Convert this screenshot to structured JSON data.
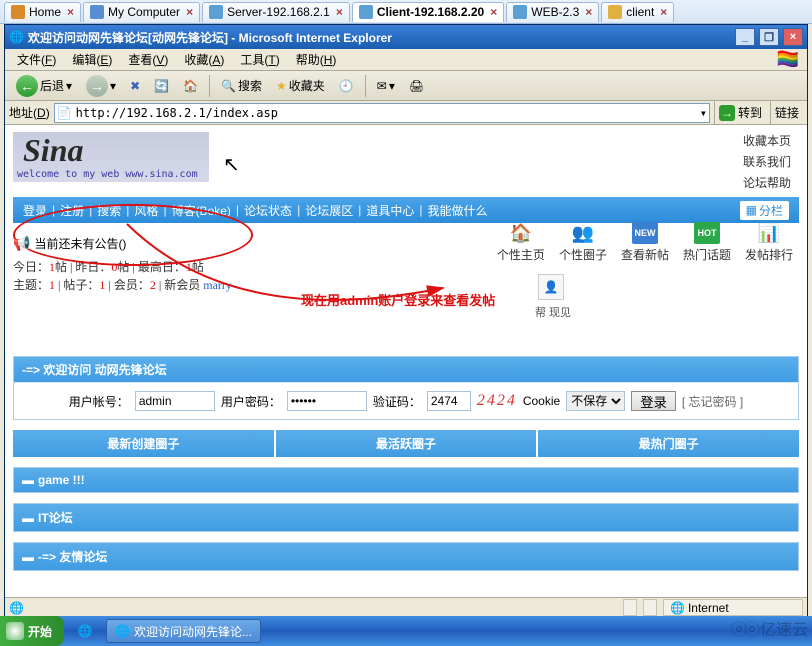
{
  "tabs": [
    {
      "label": "Home",
      "active": false,
      "icon": "#d98a2c"
    },
    {
      "label": "My Computer",
      "active": false,
      "icon": "#5a8ed4"
    },
    {
      "label": "Server-192.168.2.1",
      "active": false,
      "icon": "#5aa0d4"
    },
    {
      "label": "Client-192.168.2.20",
      "active": true,
      "icon": "#5aa0d4"
    },
    {
      "label": "WEB-2.3",
      "active": false,
      "icon": "#5aa0d4"
    },
    {
      "label": "client",
      "active": false,
      "icon": "#e0b040"
    }
  ],
  "ie_title": "欢迎访问动网先锋论坛[动网先锋论坛] - Microsoft Internet Explorer",
  "menu": [
    {
      "label": "文件",
      "u": "F"
    },
    {
      "label": "编辑",
      "u": "E"
    },
    {
      "label": "查看",
      "u": "V"
    },
    {
      "label": "收藏",
      "u": "A"
    },
    {
      "label": "工具",
      "u": "T"
    },
    {
      "label": "帮助",
      "u": "H"
    }
  ],
  "toolbar": {
    "back": "后退",
    "search": "搜索",
    "favorites": "收藏夹"
  },
  "address": {
    "label": "地址",
    "url": "http://192.168.2.1/index.asp",
    "go": "转到",
    "links": "链接"
  },
  "logo": {
    "text": "Sina",
    "sub": "welcome to my web www.sina.com"
  },
  "right_links": [
    "收藏本页",
    "联系我们",
    "论坛帮助"
  ],
  "forum_nav": [
    "登录",
    "注册",
    "搜索",
    "风格",
    "博客(Boke)",
    "论坛状态",
    "论坛展区",
    "道具中心",
    "我能做什么"
  ],
  "share": "分栏",
  "announce": "当前还未有公告()",
  "stats": {
    "line1_pre": "今日：",
    "today": "1",
    "line1_mid": "帖 | 昨日：",
    "yest": "0",
    "line1_mid2": "帖 | 最高日：",
    "high": "1",
    "line1_end": "帖",
    "line2_pre": "主题：",
    "topics": "1",
    "line2_mid": " | 帖子：",
    "posts": "1",
    "line2_mid2": " | 会员：",
    "members": "2",
    "line2_mid3": " | 新会员 ",
    "newmember": "marry"
  },
  "icons": [
    {
      "label": "个性主页",
      "emoji": "🏠",
      "color": "#e8a642"
    },
    {
      "label": "个性圈子",
      "emoji": "👥",
      "color": "#4a8fd6"
    },
    {
      "label": "查看新帖",
      "emoji": "NEW",
      "color": "#3a7fd0",
      "small": true
    },
    {
      "label": "热门话题",
      "emoji": "HOT",
      "color": "#2aa84a",
      "small": true
    },
    {
      "label": "发帖排行",
      "emoji": "📊",
      "color": "#d68a2c"
    }
  ],
  "avatar_below": "帮 现见",
  "red_note": "现在用admin账户登录来查看发帖",
  "login": {
    "panel_title": "-=> 欢迎访问 动网先锋论坛",
    "user_label": "用户帐号：",
    "user_value": "admin",
    "pwd_label": "用户密码：",
    "pwd_value": "••••••",
    "code_label": "验证码：",
    "code_value": "2474",
    "captcha_display": "2424",
    "cookie_label": "Cookie",
    "cookie_select": "不保存",
    "button": "登录",
    "forgot": "[ 忘记密码 ]"
  },
  "three_cols": [
    "最新创建圈子",
    "最活跃圈子",
    "最热门圈子"
  ],
  "sections": [
    "game !!!",
    "IT论坛",
    "-=> 友情论坛"
  ],
  "status": {
    "internet": "Internet"
  },
  "taskbar": {
    "start": "开始",
    "task": "欢迎访问动网先锋论..."
  },
  "watermark": "亿速云"
}
